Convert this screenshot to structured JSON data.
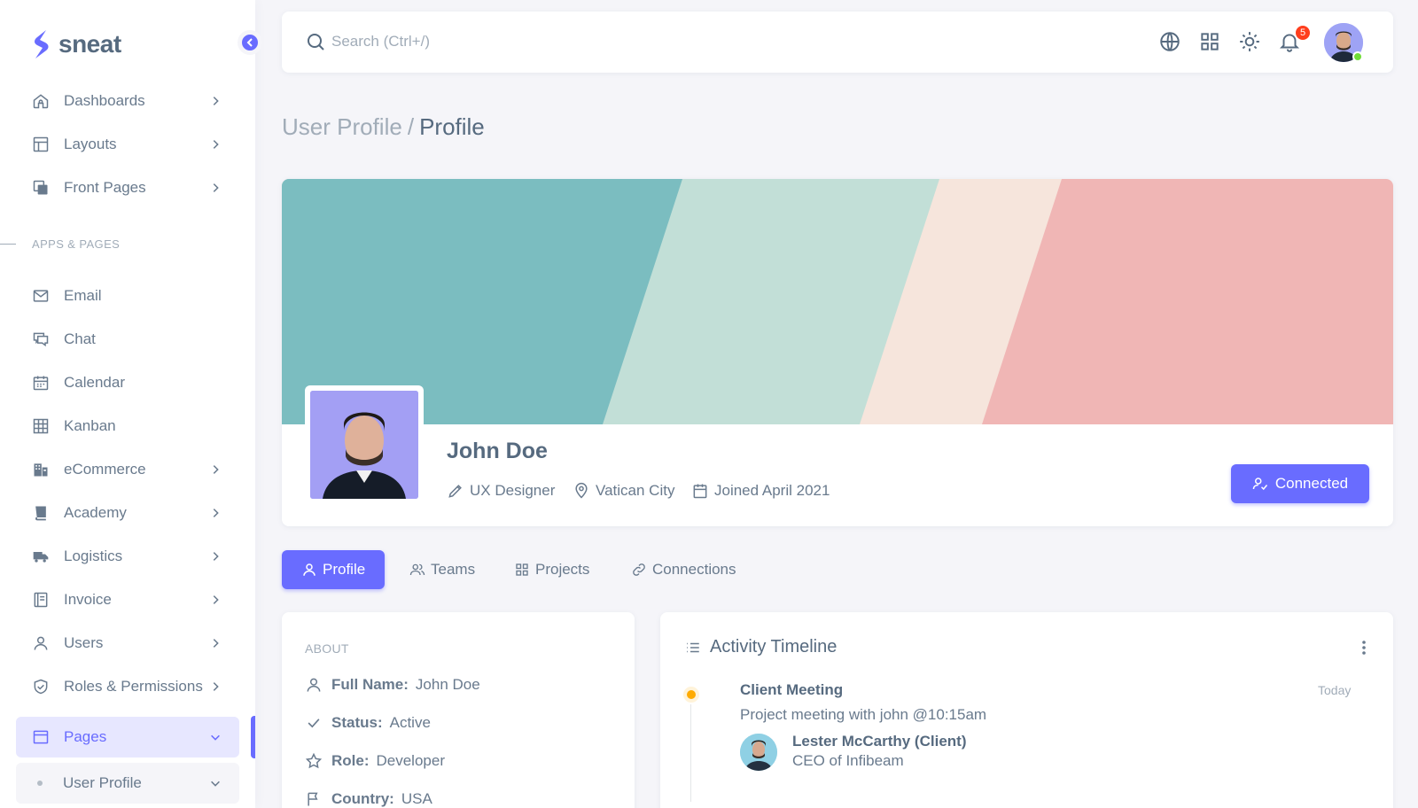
{
  "brand": {
    "name": "sneat",
    "accent": "#696cff"
  },
  "sidebar": {
    "items": [
      {
        "label": "Dashboards",
        "icon": "home-icon"
      },
      {
        "label": "Layouts",
        "icon": "layout-icon"
      },
      {
        "label": "Front Pages",
        "icon": "copy-icon"
      }
    ],
    "section_header": "APPS & PAGES",
    "apps": [
      {
        "label": "Email",
        "icon": "envelope-icon"
      },
      {
        "label": "Chat",
        "icon": "chat-icon"
      },
      {
        "label": "Calendar",
        "icon": "calendar-icon"
      },
      {
        "label": "Kanban",
        "icon": "grid-icon"
      },
      {
        "label": "eCommerce",
        "icon": "buildings-icon"
      },
      {
        "label": "Academy",
        "icon": "book-icon"
      },
      {
        "label": "Logistics",
        "icon": "truck-icon"
      },
      {
        "label": "Invoice",
        "icon": "receipt-icon"
      },
      {
        "label": "Users",
        "icon": "user-icon"
      },
      {
        "label": "Roles & Permissions",
        "icon": "shield-check-icon"
      },
      {
        "label": "Pages",
        "icon": "window-icon"
      },
      {
        "label": "User Profile",
        "icon": "dot-icon"
      }
    ]
  },
  "navbar": {
    "search_placeholder": "Search (Ctrl+/)",
    "notification_count": "5"
  },
  "breadcrumb": {
    "parent": "User Profile",
    "separator": "/",
    "current": "Profile"
  },
  "profile": {
    "name": "John Doe",
    "title": "UX Designer",
    "location": "Vatican City",
    "joined": "Joined April 2021",
    "connect_button": "Connected"
  },
  "tabs": [
    {
      "label": "Profile",
      "icon": "user-icon"
    },
    {
      "label": "Teams",
      "icon": "users-icon"
    },
    {
      "label": "Projects",
      "icon": "grid-icon"
    },
    {
      "label": "Connections",
      "icon": "link-icon"
    }
  ],
  "about": {
    "heading": "ABOUT",
    "rows": [
      {
        "key": "Full Name:",
        "value": "John Doe",
        "icon": "user-icon"
      },
      {
        "key": "Status:",
        "value": "Active",
        "icon": "check-icon"
      },
      {
        "key": "Role:",
        "value": "Developer",
        "icon": "star-icon"
      },
      {
        "key": "Country:",
        "value": "USA",
        "icon": "flag-icon"
      }
    ]
  },
  "timeline": {
    "title": "Activity Timeline",
    "event": {
      "title": "Client Meeting",
      "time": "Today",
      "description": "Project meeting with john @10:15am",
      "person_name": "Lester McCarthy (Client)",
      "person_role": "CEO of Infibeam"
    }
  }
}
